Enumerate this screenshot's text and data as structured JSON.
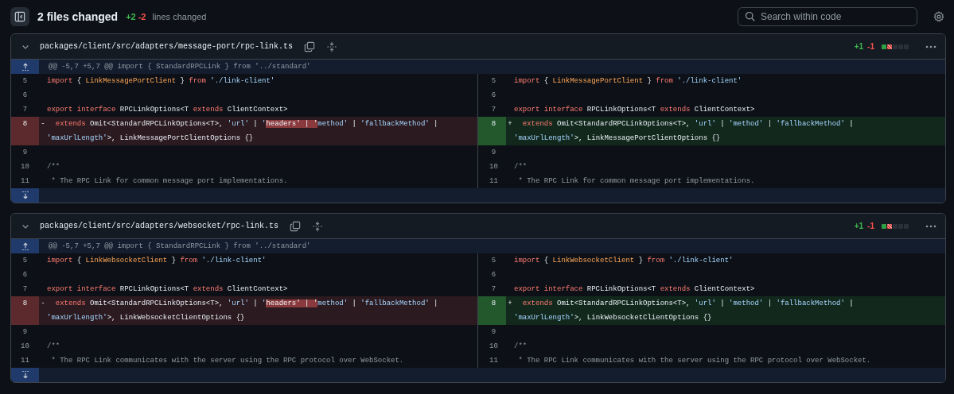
{
  "header": {
    "title": "2 files changed",
    "added": "+2",
    "removed": "-2",
    "caption": "lines changed"
  },
  "search": {
    "placeholder": "Search within code"
  },
  "files": [
    {
      "path": "packages/client/src/adapters/message-port/rpc-link.ts",
      "added": "+1",
      "removed": "-1",
      "diffstat": [
        {
          "kind": "add"
        },
        {
          "kind": "del"
        },
        {
          "kind": "neutral"
        },
        {
          "kind": "neutral"
        },
        {
          "kind": "neutral"
        }
      ],
      "hunk": "@@ -5,7 +5,7 @@ import { StandardRPCLink } from '../standard'",
      "rows": [
        {
          "left": {
            "num": "5",
            "kind": "ctx",
            "code": [
              [
                {
                  "text": "import",
                  "kind": "kw"
                },
                {
                  "text": " { ",
                  "kind": "p"
                },
                {
                  "text": "LinkMessagePortClient",
                  "kind": "fn"
                },
                {
                  "text": " } ",
                  "kind": "p"
                },
                {
                  "text": "from",
                  "kind": "kw"
                },
                {
                  "text": " './link-client'",
                  "kind": "str"
                }
              ]
            ]
          },
          "right": {
            "num": "5",
            "kind": "ctx",
            "code": [
              [
                {
                  "text": "import",
                  "kind": "kw"
                },
                {
                  "text": " { ",
                  "kind": "p"
                },
                {
                  "text": "LinkMessagePortClient",
                  "kind": "fn"
                },
                {
                  "text": " } ",
                  "kind": "p"
                },
                {
                  "text": "from",
                  "kind": "kw"
                },
                {
                  "text": " './link-client'",
                  "kind": "str"
                }
              ]
            ]
          }
        },
        {
          "left": {
            "num": "6",
            "kind": "ctx"
          },
          "right": {
            "num": "6",
            "kind": "ctx"
          }
        },
        {
          "left": {
            "num": "7",
            "kind": "ctx",
            "code": [
              [
                {
                  "text": "export interface",
                  "kind": "kw"
                },
                {
                  "text": " RPCLinkOptions<T ",
                  "kind": "p"
                },
                {
                  "text": "extends",
                  "kind": "kw"
                },
                {
                  "text": " ClientContext>",
                  "kind": "p"
                }
              ]
            ]
          },
          "right": {
            "num": "7",
            "kind": "ctx",
            "code": [
              [
                {
                  "text": "export interface",
                  "kind": "kw"
                },
                {
                  "text": " RPCLinkOptions<T ",
                  "kind": "p"
                },
                {
                  "text": "extends",
                  "kind": "kw"
                },
                {
                  "text": " ClientContext>",
                  "kind": "p"
                }
              ]
            ]
          }
        },
        {
          "left": {
            "num": "8",
            "kind": "del",
            "sign": "-",
            "code": [
              [
                {
                  "text": "  extends",
                  "kind": "kw"
                },
                {
                  "text": " Omit<StandardRPCLinkOptions<T>, ",
                  "kind": "p"
                },
                {
                  "text": "'url'",
                  "kind": "str"
                },
                {
                  "text": " | ",
                  "kind": "p"
                },
                {
                  "text": "'",
                  "kind": "str"
                },
                {
                  "text": "headers' | '",
                  "kind": "hl"
                },
                {
                  "text": "method'",
                  "kind": "str"
                },
                {
                  "text": " | ",
                  "kind": "p"
                },
                {
                  "text": "'fallbackMethod'",
                  "kind": "str"
                },
                {
                  "text": " |",
                  "kind": "p"
                }
              ],
              [
                {
                  "text": "'maxUrlLength'",
                  "kind": "str"
                },
                {
                  "text": ">, LinkMessagePortClientOptions {}",
                  "kind": "p"
                }
              ]
            ]
          },
          "right": {
            "num": "8",
            "kind": "add",
            "sign": "+",
            "code": [
              [
                {
                  "text": "  extends",
                  "kind": "kw"
                },
                {
                  "text": " Omit<StandardRPCLinkOptions<T>, ",
                  "kind": "p"
                },
                {
                  "text": "'url'",
                  "kind": "str"
                },
                {
                  "text": " | ",
                  "kind": "p"
                },
                {
                  "text": "'method'",
                  "kind": "str"
                },
                {
                  "text": " | ",
                  "kind": "p"
                },
                {
                  "text": "'fallbackMethod'",
                  "kind": "str"
                },
                {
                  "text": " |",
                  "kind": "p"
                }
              ],
              [
                {
                  "text": "'maxUrlLength'",
                  "kind": "str"
                },
                {
                  "text": ">, LinkMessagePortClientOptions {}",
                  "kind": "p"
                }
              ]
            ]
          }
        },
        {
          "left": {
            "num": "9",
            "kind": "ctx"
          },
          "right": {
            "num": "9",
            "kind": "ctx"
          }
        },
        {
          "left": {
            "num": "10",
            "kind": "ctx",
            "code": [
              [
                {
                  "text": "/**",
                  "kind": "cm"
                }
              ]
            ]
          },
          "right": {
            "num": "10",
            "kind": "ctx",
            "code": [
              [
                {
                  "text": "/**",
                  "kind": "cm"
                }
              ]
            ]
          }
        },
        {
          "left": {
            "num": "11",
            "kind": "ctx",
            "code": [
              [
                {
                  "text": " * The RPC Link for common message port implementations.",
                  "kind": "cm"
                }
              ]
            ]
          },
          "right": {
            "num": "11",
            "kind": "ctx",
            "code": [
              [
                {
                  "text": " * The RPC Link for common message port implementations.",
                  "kind": "cm"
                }
              ]
            ]
          }
        }
      ]
    },
    {
      "path": "packages/client/src/adapters/websocket/rpc-link.ts",
      "added": "+1",
      "removed": "-1",
      "diffstat": [
        {
          "kind": "add"
        },
        {
          "kind": "del"
        },
        {
          "kind": "neutral"
        },
        {
          "kind": "neutral"
        },
        {
          "kind": "neutral"
        }
      ],
      "hunk": "@@ -5,7 +5,7 @@ import { StandardRPCLink } from '../standard'",
      "rows": [
        {
          "left": {
            "num": "5",
            "kind": "ctx",
            "code": [
              [
                {
                  "text": "import",
                  "kind": "kw"
                },
                {
                  "text": " { ",
                  "kind": "p"
                },
                {
                  "text": "LinkWebsocketClient",
                  "kind": "fn"
                },
                {
                  "text": " } ",
                  "kind": "p"
                },
                {
                  "text": "from",
                  "kind": "kw"
                },
                {
                  "text": " './link-client'",
                  "kind": "str"
                }
              ]
            ]
          },
          "right": {
            "num": "5",
            "kind": "ctx",
            "code": [
              [
                {
                  "text": "import",
                  "kind": "kw"
                },
                {
                  "text": " { ",
                  "kind": "p"
                },
                {
                  "text": "LinkWebsocketClient",
                  "kind": "fn"
                },
                {
                  "text": " } ",
                  "kind": "p"
                },
                {
                  "text": "from",
                  "kind": "kw"
                },
                {
                  "text": " './link-client'",
                  "kind": "str"
                }
              ]
            ]
          }
        },
        {
          "left": {
            "num": "6",
            "kind": "ctx"
          },
          "right": {
            "num": "6",
            "kind": "ctx"
          }
        },
        {
          "left": {
            "num": "7",
            "kind": "ctx",
            "code": [
              [
                {
                  "text": "export interface",
                  "kind": "kw"
                },
                {
                  "text": " RPCLinkOptions<T ",
                  "kind": "p"
                },
                {
                  "text": "extends",
                  "kind": "kw"
                },
                {
                  "text": " ClientContext>",
                  "kind": "p"
                }
              ]
            ]
          },
          "right": {
            "num": "7",
            "kind": "ctx",
            "code": [
              [
                {
                  "text": "export interface",
                  "kind": "kw"
                },
                {
                  "text": " RPCLinkOptions<T ",
                  "kind": "p"
                },
                {
                  "text": "extends",
                  "kind": "kw"
                },
                {
                  "text": " ClientContext>",
                  "kind": "p"
                }
              ]
            ]
          }
        },
        {
          "left": {
            "num": "8",
            "kind": "del",
            "sign": "-",
            "code": [
              [
                {
                  "text": "  extends",
                  "kind": "kw"
                },
                {
                  "text": " Omit<StandardRPCLinkOptions<T>, ",
                  "kind": "p"
                },
                {
                  "text": "'url'",
                  "kind": "str"
                },
                {
                  "text": " | ",
                  "kind": "p"
                },
                {
                  "text": "'",
                  "kind": "str"
                },
                {
                  "text": "headers' | '",
                  "kind": "hl"
                },
                {
                  "text": "method'",
                  "kind": "str"
                },
                {
                  "text": " | ",
                  "kind": "p"
                },
                {
                  "text": "'fallbackMethod'",
                  "kind": "str"
                },
                {
                  "text": " |",
                  "kind": "p"
                }
              ],
              [
                {
                  "text": "'maxUrlLength'",
                  "kind": "str"
                },
                {
                  "text": ">, LinkWebsocketClientOptions {}",
                  "kind": "p"
                }
              ]
            ]
          },
          "right": {
            "num": "8",
            "kind": "add",
            "sign": "+",
            "code": [
              [
                {
                  "text": "  extends",
                  "kind": "kw"
                },
                {
                  "text": " Omit<StandardRPCLinkOptions<T>, ",
                  "kind": "p"
                },
                {
                  "text": "'url'",
                  "kind": "str"
                },
                {
                  "text": " | ",
                  "kind": "p"
                },
                {
                  "text": "'method'",
                  "kind": "str"
                },
                {
                  "text": " | ",
                  "kind": "p"
                },
                {
                  "text": "'fallbackMethod'",
                  "kind": "str"
                },
                {
                  "text": " |",
                  "kind": "p"
                }
              ],
              [
                {
                  "text": "'maxUrlLength'",
                  "kind": "str"
                },
                {
                  "text": ">, LinkWebsocketClientOptions {}",
                  "kind": "p"
                }
              ]
            ]
          }
        },
        {
          "left": {
            "num": "9",
            "kind": "ctx"
          },
          "right": {
            "num": "9",
            "kind": "ctx"
          }
        },
        {
          "left": {
            "num": "10",
            "kind": "ctx",
            "code": [
              [
                {
                  "text": "/**",
                  "kind": "cm"
                }
              ]
            ]
          },
          "right": {
            "num": "10",
            "kind": "ctx",
            "code": [
              [
                {
                  "text": "/**",
                  "kind": "cm"
                }
              ]
            ]
          }
        },
        {
          "left": {
            "num": "11",
            "kind": "ctx",
            "code": [
              [
                {
                  "text": " * The RPC Link communicates with the server using the RPC protocol over WebSocket.",
                  "kind": "cm"
                }
              ]
            ]
          },
          "right": {
            "num": "11",
            "kind": "ctx",
            "code": [
              [
                {
                  "text": " * The RPC Link communicates with the server using the RPC protocol over WebSocket.",
                  "kind": "cm"
                }
              ]
            ]
          }
        }
      ]
    }
  ]
}
